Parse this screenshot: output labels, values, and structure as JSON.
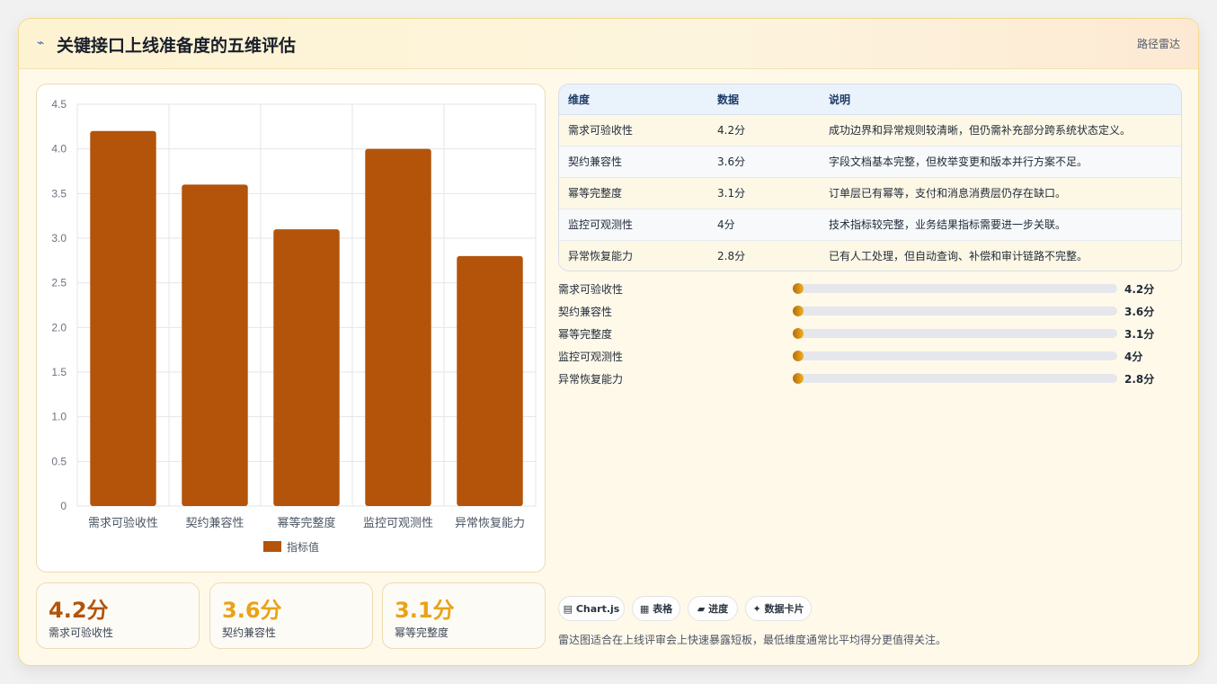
{
  "header": {
    "icon": "lightning-icon",
    "title": "关键接口上线准备度的五维评估",
    "tag": "路径雷达"
  },
  "chart_data": {
    "type": "bar",
    "categories": [
      "需求可验收性",
      "契约兼容性",
      "幂等完整度",
      "监控可观测性",
      "异常恢复能力"
    ],
    "series": [
      {
        "name": "指标值",
        "values": [
          4.2,
          3.6,
          3.1,
          4.0,
          2.8
        ],
        "color": "#b3540a"
      }
    ],
    "ylim": [
      0,
      4.5
    ],
    "yticks": [
      "0",
      "0.5",
      "1.0",
      "1.5",
      "2.0",
      "2.5",
      "3.0",
      "3.5",
      "4.0",
      "4.5"
    ],
    "ytick_values": [
      0,
      0.5,
      1.0,
      1.5,
      2.0,
      2.5,
      3.0,
      3.5,
      4.0,
      4.5
    ],
    "legend_position": "bottom",
    "grid": true
  },
  "stats": [
    {
      "value": "4.2分",
      "label": "需求可验收性",
      "color": "#b3540a"
    },
    {
      "value": "3.6分",
      "label": "契约兼容性",
      "color": "#e8a317"
    },
    {
      "value": "3.1分",
      "label": "幂等完整度",
      "color": "#e8a317"
    }
  ],
  "table": {
    "headers": [
      "维度",
      "数据",
      "说明"
    ],
    "rows": [
      [
        "需求可验收性",
        "4.2分",
        "成功边界和异常规则较清晰，但仍需补充部分跨系统状态定义。"
      ],
      [
        "契约兼容性",
        "3.6分",
        "字段文档基本完整，但枚举变更和版本并行方案不足。"
      ],
      [
        "幂等完整度",
        "3.1分",
        "订单层已有幂等，支付和消息消费层仍存在缺口。"
      ],
      [
        "监控可观测性",
        "4分",
        "技术指标较完整，业务结果指标需要进一步关联。"
      ],
      [
        "异常恢复能力",
        "2.8分",
        "已有人工处理，但自动查询、补偿和审计链路不完整。"
      ]
    ]
  },
  "progress": [
    {
      "label": "需求可验收性",
      "value": "4.2分"
    },
    {
      "label": "契约兼容性",
      "value": "3.6分"
    },
    {
      "label": "幂等完整度",
      "value": "3.1分"
    },
    {
      "label": "监控可观测性",
      "value": "4分"
    },
    {
      "label": "异常恢复能力",
      "value": "2.8分"
    }
  ],
  "chips": [
    {
      "label": "▤ Chart.js"
    },
    {
      "label": "▦ 表格"
    },
    {
      "label": "▰ 进度"
    },
    {
      "label": "✦ 数据卡片"
    }
  ],
  "footnote": "雷达图适合在上线评审会上快速暴露短板，最低维度通常比平均得分更值得关注。"
}
